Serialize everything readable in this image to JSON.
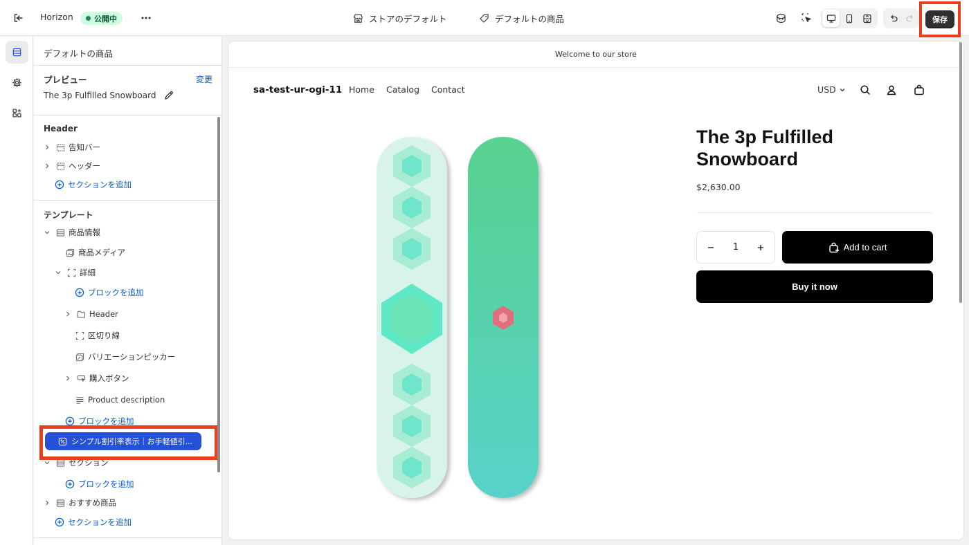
{
  "topbar": {
    "theme_name": "Horizon",
    "status_badge": "公開中",
    "store_template_selector": "ストアのデフォルト",
    "product_template_selector": "デフォルトの商品",
    "save_label": "保存"
  },
  "panel": {
    "title": "デフォルトの商品",
    "preview_label": "プレビュー",
    "change_link": "変更",
    "preview_product": "The 3p Fulfilled Snowboard",
    "header_group": "Header",
    "header_items": [
      {
        "label": "告知バー",
        "icon": "section-icon"
      },
      {
        "label": "ヘッダー",
        "icon": "section-icon"
      }
    ],
    "add_section_label": "セクションを追加",
    "template_group": "テンプレート",
    "template_items": [
      {
        "label": "商品情報"
      },
      {
        "label": "商品メディア"
      },
      {
        "label": "詳細"
      },
      {
        "label": "ブロックを追加"
      },
      {
        "label": "Header"
      },
      {
        "label": "区切り線"
      },
      {
        "label": "バリエーションピッカー"
      },
      {
        "label": "購入ボタン"
      },
      {
        "label": "Product description"
      },
      {
        "label": "ブロックを追加"
      },
      {
        "label": "シンプル割引率表示｜お手軽値引..."
      },
      {
        "label": "セクション"
      },
      {
        "label": "ブロックを追加"
      },
      {
        "label": "おすすめ商品"
      },
      {
        "label": "セクションを追加"
      }
    ]
  },
  "store": {
    "announcement": "Welcome to our store",
    "name": "sa-test-ur-ogi-11",
    "nav": [
      "Home",
      "Catalog",
      "Contact"
    ],
    "currency": "USD"
  },
  "product": {
    "title": "The 3p Fulfilled Snowboard",
    "price": "$2,630.00",
    "quantity": "1",
    "add_to_cart": "Add to cart",
    "buy_now": "Buy it now"
  },
  "colors": {
    "accent_red": "#e8401c",
    "app_block_blue": "#2451d6",
    "link_blue": "#005bd3",
    "live_green": "#cdfee1"
  }
}
